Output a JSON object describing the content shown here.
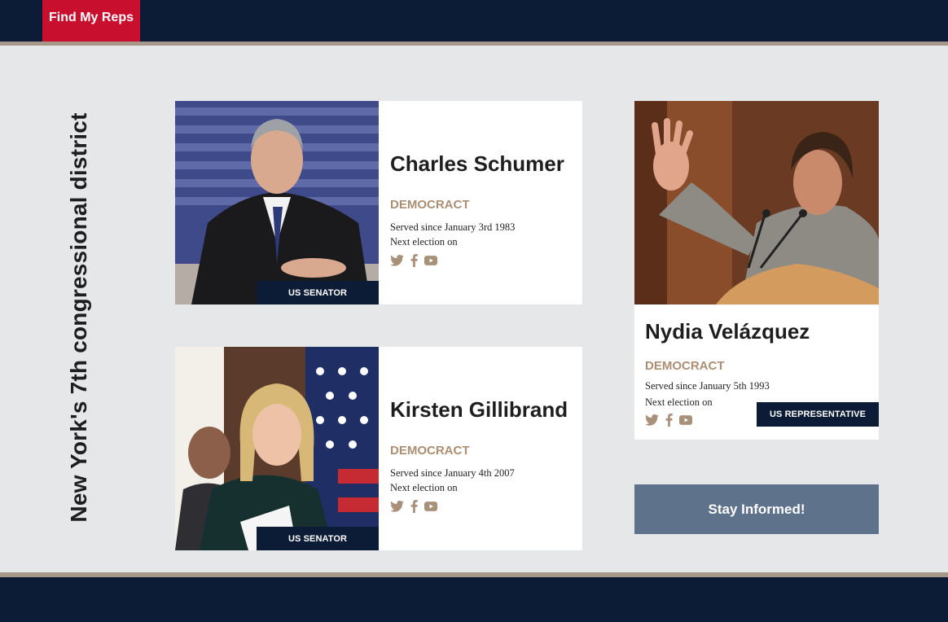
{
  "header": {
    "brand": "Find My Reps"
  },
  "district_title": "New York's 7th congressional district",
  "colors": {
    "navy": "#0c1c36",
    "brand_red": "#c8102e",
    "party_tan": "#ac8f72",
    "cta_slate": "#5f728b",
    "accent_stripe": "#a8988a"
  },
  "reps": [
    {
      "name": "Charles Schumer",
      "party": "DEMOCRACT",
      "served": "Served since January 3rd 1983",
      "next_election": "Next election on",
      "role": "US SENATOR",
      "socials": [
        "twitter-icon",
        "facebook-icon",
        "youtube-icon"
      ]
    },
    {
      "name": "Kirsten Gillibrand",
      "party": "DEMOCRACT",
      "served": "Served since January 4th 2007",
      "next_election": "Next election on",
      "role": "US SENATOR",
      "socials": [
        "twitter-icon",
        "facebook-icon",
        "youtube-icon"
      ]
    },
    {
      "name": "Nydia Velázquez",
      "party": "DEMOCRACT",
      "served": "Served since January 5th 1993",
      "next_election": "Next election on",
      "role": "US REPRESENTATIVE",
      "socials": [
        "twitter-icon",
        "facebook-icon",
        "youtube-icon"
      ]
    }
  ],
  "cta": {
    "label": "Stay Informed!"
  }
}
